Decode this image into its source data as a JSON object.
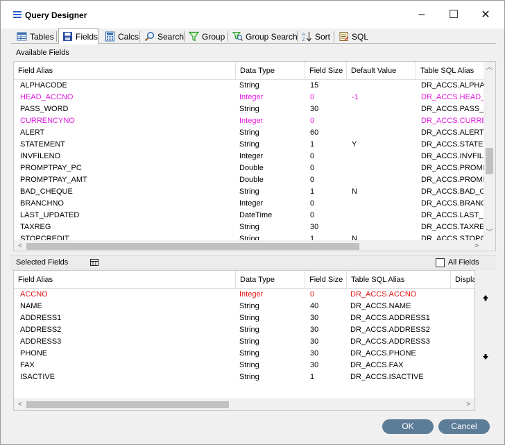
{
  "window": {
    "title": "Query Designer",
    "controls": {
      "minimize": "–",
      "maximize": "☐",
      "close": "✕"
    }
  },
  "tabs": [
    {
      "label": "Tables",
      "icon": "table-icon"
    },
    {
      "label": "Fields",
      "icon": "save-icon",
      "active": true
    },
    {
      "label": "Calcs",
      "icon": "calculator-icon"
    },
    {
      "label": "Search",
      "icon": "search-icon"
    },
    {
      "label": "Group",
      "icon": "filter-icon"
    },
    {
      "label": "Group Search",
      "icon": "filter-search-icon"
    },
    {
      "label": "Sort",
      "icon": "sort-az-icon"
    },
    {
      "label": "SQL",
      "icon": "sql-icon"
    }
  ],
  "available": {
    "label": "Available Fields",
    "columns": [
      "Field Alias",
      "Data Type",
      "Field Size",
      "Default Value",
      "Table SQL Alias"
    ],
    "rows": [
      {
        "alias": "ALPHACODE",
        "type": "String",
        "size": "15",
        "default": "",
        "sql": "DR_ACCS.ALPHAC",
        "style": ""
      },
      {
        "alias": "HEAD_ACCNO",
        "type": "Integer",
        "size": "0",
        "default": "-1",
        "sql": "DR_ACCS.HEAD_A",
        "style": "magenta"
      },
      {
        "alias": "PASS_WORD",
        "type": "String",
        "size": "30",
        "default": "",
        "sql": "DR_ACCS.PASS_W",
        "style": ""
      },
      {
        "alias": "CURRENCYNO",
        "type": "Integer",
        "size": "0",
        "default": "",
        "sql": "DR_ACCS.CURREN",
        "style": "magenta"
      },
      {
        "alias": "ALERT",
        "type": "String",
        "size": "60",
        "default": "",
        "sql": "DR_ACCS.ALERT",
        "style": ""
      },
      {
        "alias": "STATEMENT",
        "type": "String",
        "size": "1",
        "default": "Y",
        "sql": "DR_ACCS.STATEM",
        "style": ""
      },
      {
        "alias": "INVFILENO",
        "type": "Integer",
        "size": "0",
        "default": "",
        "sql": "DR_ACCS.INVFILE",
        "style": ""
      },
      {
        "alias": "PROMPTPAY_PC",
        "type": "Double",
        "size": "0",
        "default": "",
        "sql": "DR_ACCS.PROMPT",
        "style": ""
      },
      {
        "alias": "PROMPTPAY_AMT",
        "type": "Double",
        "size": "0",
        "default": "",
        "sql": "DR_ACCS.PROMPT",
        "style": ""
      },
      {
        "alias": "BAD_CHEQUE",
        "type": "String",
        "size": "1",
        "default": "N",
        "sql": "DR_ACCS.BAD_CH",
        "style": ""
      },
      {
        "alias": "BRANCHNO",
        "type": "Integer",
        "size": "0",
        "default": "",
        "sql": "DR_ACCS.BRANCH",
        "style": ""
      },
      {
        "alias": "LAST_UPDATED",
        "type": "DateTime",
        "size": "0",
        "default": "",
        "sql": "DR_ACCS.LAST_UI",
        "style": ""
      },
      {
        "alias": "TAXREG",
        "type": "String",
        "size": "30",
        "default": "",
        "sql": "DR_ACCS.TAXREG",
        "style": ""
      },
      {
        "alias": "STOPCREDIT",
        "type": "String",
        "size": "1",
        "default": "N",
        "sql": "DR_ACCS.STOPCR",
        "style": ""
      }
    ]
  },
  "selected": {
    "label": "Selected Fields",
    "toggle_icon": "grid-toggle-icon",
    "all_fields_label": "All Fields",
    "all_fields_checked": false,
    "columns": [
      "Field Alias",
      "Data Type",
      "Field Size",
      "Table SQL Alias",
      "Displa"
    ],
    "rows": [
      {
        "alias": "ACCNO",
        "type": "Integer",
        "size": "0",
        "sql": "DR_ACCS.ACCNO",
        "style": "red"
      },
      {
        "alias": "NAME",
        "type": "String",
        "size": "40",
        "sql": "DR_ACCS.NAME",
        "style": ""
      },
      {
        "alias": "ADDRESS1",
        "type": "String",
        "size": "30",
        "sql": "DR_ACCS.ADDRESS1",
        "style": ""
      },
      {
        "alias": "ADDRESS2",
        "type": "String",
        "size": "30",
        "sql": "DR_ACCS.ADDRESS2",
        "style": ""
      },
      {
        "alias": "ADDRESS3",
        "type": "String",
        "size": "30",
        "sql": "DR_ACCS.ADDRESS3",
        "style": ""
      },
      {
        "alias": "PHONE",
        "type": "String",
        "size": "30",
        "sql": "DR_ACCS.PHONE",
        "style": ""
      },
      {
        "alias": "FAX",
        "type": "String",
        "size": "30",
        "sql": "DR_ACCS.FAX",
        "style": ""
      },
      {
        "alias": "ISACTIVE",
        "type": "String",
        "size": "1",
        "sql": "DR_ACCS.ISACTIVE",
        "style": ""
      }
    ]
  },
  "move_up_icon": "move-up-icon",
  "move_down_icon": "move-down-icon",
  "buttons": {
    "ok": "OK",
    "cancel": "Cancel"
  },
  "colors": {
    "magenta_row": "#e01be0",
    "red_row": "#e01010",
    "button": "#5d7c97",
    "title_icon": "#2e62c9"
  }
}
